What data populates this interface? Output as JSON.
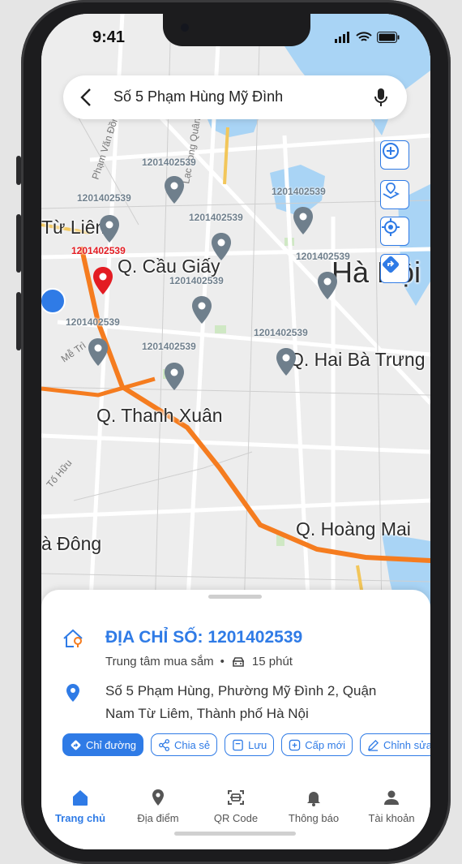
{
  "status": {
    "time": "9:41"
  },
  "search": {
    "query": "Số 5 Phạm Hùng Mỹ Đình"
  },
  "map": {
    "pin_labels": [
      "1201402539",
      "1201402539",
      "1201402539",
      "1201402539",
      "1201402539",
      "1201402539",
      "1201402539",
      "1201402539",
      "1201402539",
      "1201402539"
    ],
    "selected_pin_label": "1201402539",
    "districts": [
      "Từ Liêm",
      "Q. Cầu Giấy",
      "Hà Nội",
      "Q. Hai Bà Trưng",
      "Q. Thanh Xuân",
      "Q. Hoàng Mai",
      "à Đông"
    ],
    "street_labels": [
      "Phạm Văn Đồng",
      "Lạc Long Quân",
      "Mễ Trì",
      "Tố Hữu"
    ]
  },
  "place": {
    "title": "ĐỊA CHỈ SỐ: 1201402539",
    "category": "Trung tâm mua sắm",
    "separator": "•",
    "duration": "15 phút",
    "address": "Số 5 Phạm Hùng, Phường Mỹ Đình 2, Quận Nam Từ Liêm, Thành phố Hà Nội"
  },
  "actions": [
    {
      "label": "Chỉ đường",
      "icon": "directions-icon"
    },
    {
      "label": "Chia sẻ",
      "icon": "share-icon"
    },
    {
      "label": "Lưu",
      "icon": "bookmark-icon"
    },
    {
      "label": "Cấp mới",
      "icon": "plus-square-icon"
    },
    {
      "label": "Chỉnh sửa",
      "icon": "pencil-icon"
    }
  ],
  "nav": [
    {
      "label": "Trang chủ",
      "icon": "home-icon",
      "active": true
    },
    {
      "label": "Địa điểm",
      "icon": "location-pin-icon",
      "active": false
    },
    {
      "label": "QR Code",
      "icon": "qr-scan-icon",
      "active": false
    },
    {
      "label": "Thông báo",
      "icon": "bell-icon",
      "active": false
    },
    {
      "label": "Tài khoản",
      "icon": "user-icon",
      "active": false
    }
  ],
  "colors": {
    "accent": "#2f7be6",
    "selected_pin": "#e31c23",
    "pin": "#6f7f8c",
    "water": "#a9d4f5",
    "route": "#f57c1f"
  }
}
